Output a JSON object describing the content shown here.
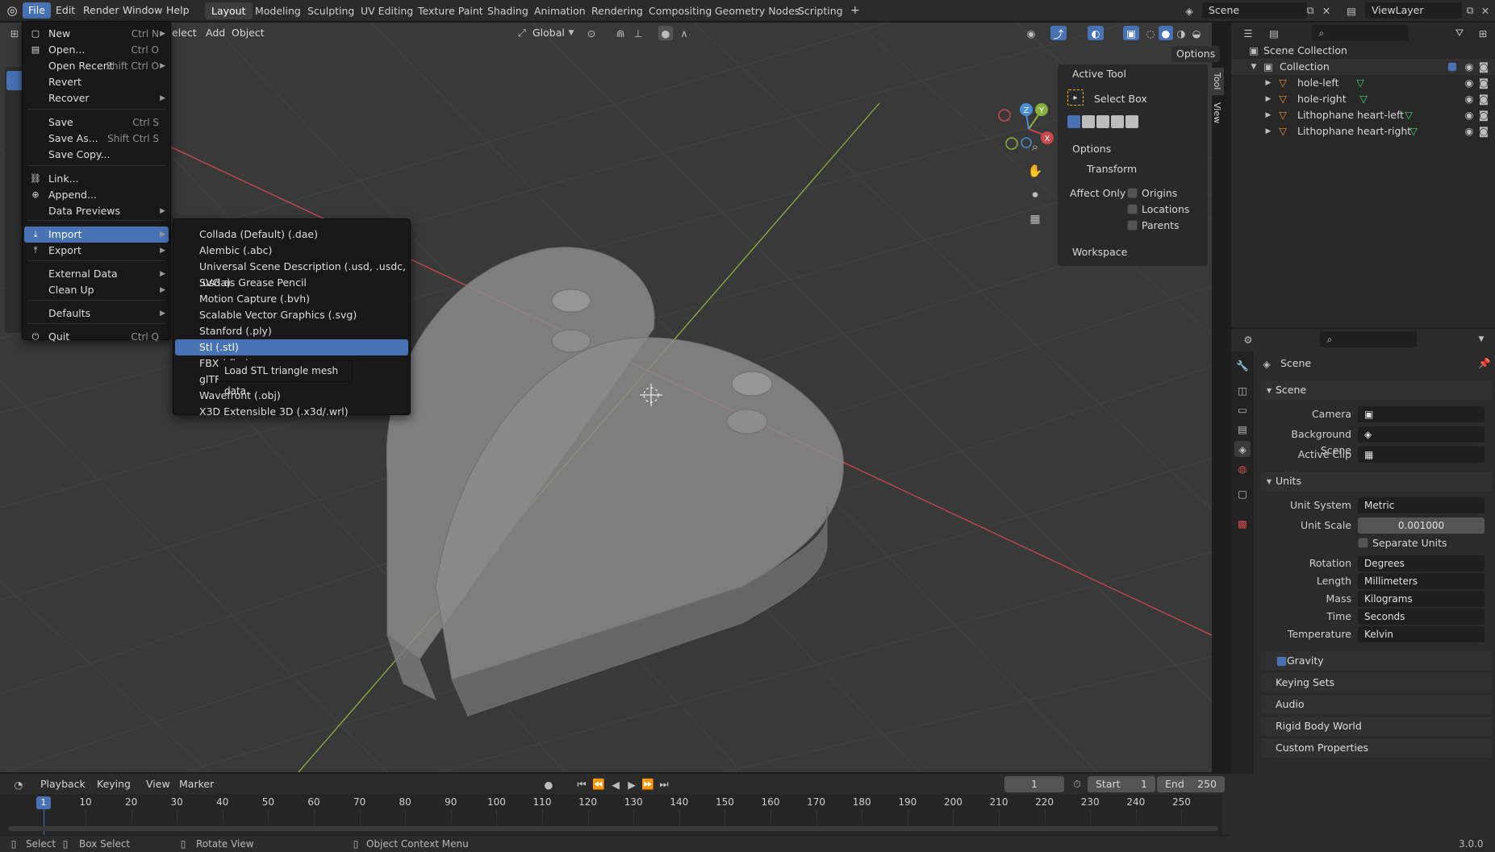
{
  "topbar": {
    "menus": [
      "File",
      "Edit",
      "Render",
      "Window",
      "Help"
    ],
    "workspaces": [
      "Layout",
      "Modeling",
      "Sculpting",
      "UV Editing",
      "Texture Paint",
      "Shading",
      "Animation",
      "Rendering",
      "Compositing",
      "Geometry Nodes",
      "Scripting"
    ],
    "add_tab": "+",
    "scene_name": "Scene",
    "view_layer": "ViewLayer"
  },
  "viewport_header": {
    "select_partial": "elect",
    "add": "Add",
    "object": "Object",
    "orientation": "Global",
    "options": "Options"
  },
  "n_panel": {
    "tabs": [
      "Tool",
      "View"
    ],
    "active_tool_title": "Active Tool",
    "tool_name": "Select Box",
    "options_title": "Options",
    "transform_title": "Transform",
    "affect_only": "Affect Only",
    "checks": [
      "Origins",
      "Locations",
      "Parents"
    ],
    "workspace_title": "Workspace"
  },
  "outliner": {
    "scene_collection": "Scene Collection",
    "collection": "Collection",
    "objects": [
      "hole-left",
      "hole-right",
      "Lithophane heart-left",
      "Lithophane heart-right"
    ]
  },
  "properties": {
    "header": "Scene",
    "scene_panel": "Scene",
    "camera_label": "Camera",
    "background_scene_label": "Background Scene",
    "active_clip_label": "Active Clip",
    "units_panel": "Units",
    "unit_system_label": "Unit System",
    "unit_system": "Metric",
    "unit_scale_label": "Unit Scale",
    "unit_scale": "0.001000",
    "separate_units": "Separate Units",
    "rotation_label": "Rotation",
    "rotation": "Degrees",
    "length_label": "Length",
    "length": "Millimeters",
    "mass_label": "Mass",
    "mass": "Kilograms",
    "time_label": "Time",
    "time": "Seconds",
    "temperature_label": "Temperature",
    "temperature": "Kelvin",
    "collapsed_panels": [
      "Gravity",
      "Keying Sets",
      "Audio",
      "Rigid Body World",
      "Custom Properties"
    ]
  },
  "file_menu": {
    "items": [
      {
        "label": "New",
        "shortcut": "Ctrl N",
        "arrow": true
      },
      {
        "label": "Open...",
        "shortcut": "Ctrl O"
      },
      {
        "label": "Open Recent",
        "shortcut": "Shift Ctrl O",
        "arrow": true
      },
      {
        "label": "Revert",
        "shortcut": ""
      },
      {
        "label": "Recover",
        "shortcut": "",
        "arrow": true
      },
      {
        "label": "Save",
        "shortcut": "Ctrl S"
      },
      {
        "label": "Save As...",
        "shortcut": "Shift Ctrl S"
      },
      {
        "label": "Save Copy...",
        "shortcut": ""
      },
      {
        "label": "Link...",
        "shortcut": ""
      },
      {
        "label": "Append...",
        "shortcut": ""
      },
      {
        "label": "Data Previews",
        "shortcut": "",
        "arrow": true
      },
      {
        "label": "Import",
        "shortcut": "",
        "arrow": true
      },
      {
        "label": "Export",
        "shortcut": "",
        "arrow": true
      },
      {
        "label": "External Data",
        "shortcut": "",
        "arrow": true
      },
      {
        "label": "Clean Up",
        "shortcut": "",
        "arrow": true
      },
      {
        "label": "Defaults",
        "shortcut": "",
        "arrow": true
      },
      {
        "label": "Quit",
        "shortcut": "Ctrl Q"
      }
    ]
  },
  "import_menu": {
    "items": [
      "Collada (Default) (.dae)",
      "Alembic (.abc)",
      "Universal Scene Description (.usd, .usdc, .usda)",
      "SVG as Grease Pencil",
      "Motion Capture (.bvh)",
      "Scalable Vector Graphics (.svg)",
      "Stanford (.ply)",
      "Stl (.stl)",
      "FBX (.fbx)",
      "glTF",
      "Wavefront (.obj)",
      "X3D Extensible 3D (.x3d/.wrl)"
    ],
    "tooltip": "Load STL triangle mesh data."
  },
  "timeline": {
    "playback": "Playback",
    "keying": "Keying",
    "view": "View",
    "marker": "Marker",
    "current_frame": "1",
    "start_label": "Start",
    "start": "1",
    "end_label": "End",
    "end": "250",
    "ticks": [
      "10",
      "20",
      "30",
      "40",
      "50",
      "60",
      "70",
      "80",
      "90",
      "100",
      "110",
      "120",
      "130",
      "140",
      "150",
      "160",
      "170",
      "180",
      "190",
      "200",
      "210",
      "220",
      "230",
      "240",
      "250"
    ]
  },
  "status": {
    "select": "Select",
    "box_select": "Box Select",
    "rotate_view": "Rotate View",
    "context_menu": "Object Context Menu",
    "version": "3.0.0"
  },
  "colors": {
    "accent": "#4772b3",
    "x_axis": "#c94a4a",
    "y_axis": "#8ab13b",
    "z_axis": "#4a8fd6"
  }
}
